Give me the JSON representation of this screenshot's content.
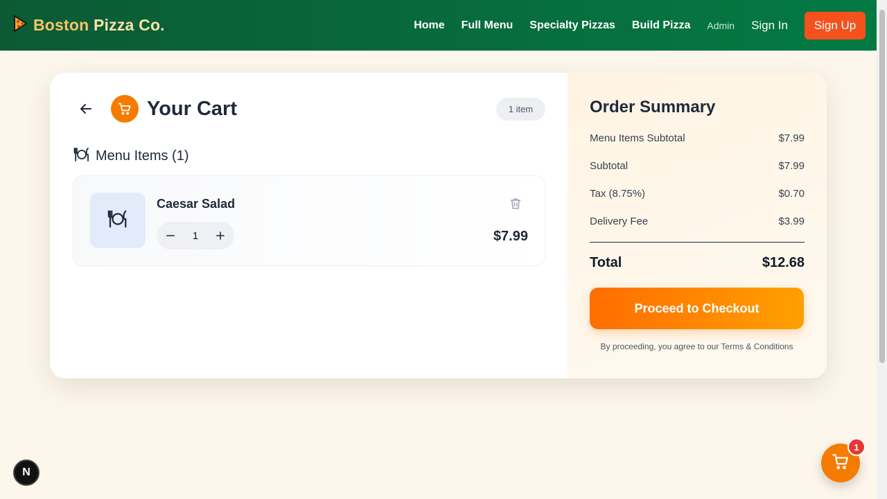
{
  "header": {
    "brand_part1": "Boston",
    "brand_part2": "Pizza Co.",
    "brand_icon": "pizza-slice-icon",
    "nav": {
      "home": "Home",
      "full_menu": "Full Menu",
      "specialty": "Specialty Pizzas",
      "build": "Build Pizza",
      "admin": "Admin",
      "sign_in": "Sign In",
      "sign_up": "Sign Up"
    }
  },
  "cart": {
    "title": "Your Cart",
    "item_count_label": "1 item",
    "section_heading": "Menu Items (1)",
    "items": [
      {
        "name": "Caesar Salad",
        "quantity": "1",
        "price": "$7.99",
        "icon": "utensils-plate-icon"
      }
    ]
  },
  "summary": {
    "title": "Order Summary",
    "rows": [
      {
        "label": "Menu Items Subtotal",
        "value": "$7.99"
      },
      {
        "label": "Subtotal",
        "value": "$7.99"
      },
      {
        "label": "Tax (8.75%)",
        "value": "$0.70"
      },
      {
        "label": "Delivery Fee",
        "value": "$3.99"
      }
    ],
    "total_label": "Total",
    "total_value": "$12.68",
    "checkout_label": "Proceed to Checkout",
    "terms": "By proceeding, you agree to our Terms & Conditions"
  },
  "floating": {
    "n_badge": "N",
    "cart_count": "1"
  },
  "colors": {
    "header_green": "#047a43",
    "accent_orange": "#f57c00",
    "signup_orange": "#f4511e",
    "badge_red": "#e53935"
  }
}
